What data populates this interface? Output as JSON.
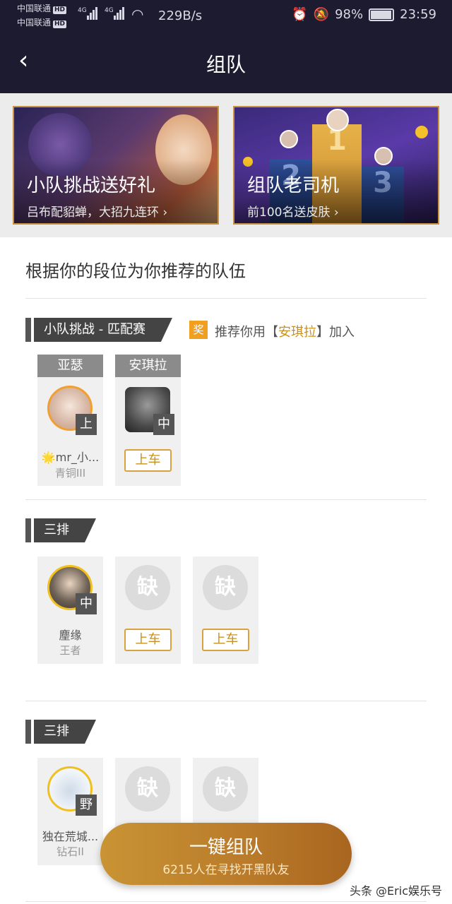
{
  "status_bar": {
    "carrier1": "中国联通",
    "carrier2": "中国联通",
    "hd": "HD",
    "net1": "4G",
    "net2": "4G",
    "speed": "229B/s",
    "battery": "98%",
    "time": "23:59"
  },
  "header": {
    "title": "组队",
    "back_icon": "back-chevron-icon"
  },
  "banners": [
    {
      "title": "小队挑战送好礼",
      "subtitle": "吕布配貂蝉，大招九连环 ›"
    },
    {
      "title": "组队老司机",
      "subtitle": "前100名送皮肤 ›",
      "podium": [
        "2",
        "1",
        "3"
      ]
    }
  ],
  "section_title": "根据你的段位为你推荐的队伍",
  "reward_text": "奖",
  "teams": [
    {
      "tag": "小队挑战 - 匹配赛",
      "recommend": {
        "prefix": "推荐你用【",
        "hero": "安琪拉",
        "suffix": "】加入"
      },
      "members": [
        {
          "hero": "亚瑟",
          "position": "上",
          "name": "🌟mr_小...",
          "rank": "青铜III"
        },
        {
          "hero": "安琪拉",
          "position": "中",
          "button": "上车"
        }
      ]
    },
    {
      "tag": "三排",
      "members": [
        {
          "position": "中",
          "name": "麈缘",
          "rank": "王者"
        },
        {
          "empty": "缺",
          "button": "上车"
        },
        {
          "empty": "缺",
          "button": "上车"
        }
      ]
    },
    {
      "tag": "三排",
      "members": [
        {
          "position": "野",
          "name": "独在荒城...",
          "rank": "钻石II"
        },
        {
          "empty": "缺"
        },
        {
          "empty": "缺"
        }
      ]
    }
  ],
  "fab": {
    "label": "一键组队",
    "sub": "6215人在寻找开黑队友"
  },
  "watermark": "头条 @Eric娱乐号",
  "colors": {
    "header_bg": "#1c1b2f",
    "accent": "#c8911f",
    "reward": "#f0a01e"
  }
}
